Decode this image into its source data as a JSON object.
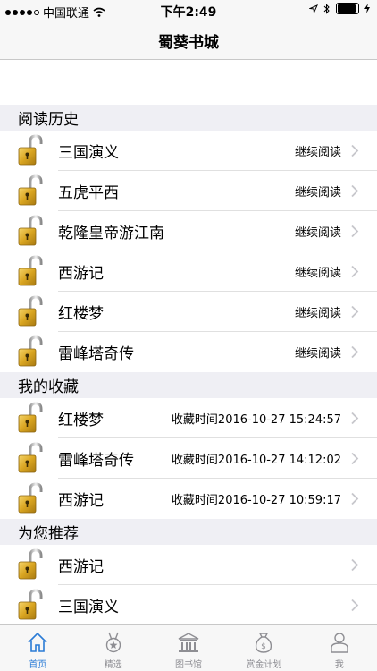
{
  "status_bar": {
    "carrier": "中国联通",
    "time": "下午2:49"
  },
  "nav": {
    "title": "蜀葵书城"
  },
  "sections": {
    "history": {
      "header": "阅读历史",
      "items": [
        {
          "title": "三国演义",
          "action": "继续阅读"
        },
        {
          "title": "五虎平西",
          "action": "继续阅读"
        },
        {
          "title": "乾隆皇帝游江南",
          "action": "继续阅读"
        },
        {
          "title": "西游记",
          "action": "继续阅读"
        },
        {
          "title": "红楼梦",
          "action": "继续阅读"
        },
        {
          "title": "雷峰塔奇传",
          "action": "继续阅读"
        }
      ]
    },
    "favorites": {
      "header": "我的收藏",
      "items": [
        {
          "title": "红楼梦",
          "time": "收藏时间2016-10-27 15:24:57"
        },
        {
          "title": "雷峰塔奇传",
          "time": "收藏时间2016-10-27 14:12:02"
        },
        {
          "title": "西游记",
          "time": "收藏时间2016-10-27 10:59:17"
        }
      ]
    },
    "recommend": {
      "header": "为您推荐",
      "items": [
        {
          "title": "西游记"
        },
        {
          "title": "三国演义"
        }
      ]
    }
  },
  "tabs": [
    {
      "label": "首页",
      "icon": "home-icon",
      "active": true
    },
    {
      "label": "精选",
      "icon": "medal-icon",
      "active": false
    },
    {
      "label": "图书馆",
      "icon": "library-icon",
      "active": false
    },
    {
      "label": "赏金计划",
      "icon": "money-bag-icon",
      "active": false
    },
    {
      "label": "我",
      "icon": "person-icon",
      "active": false
    }
  ],
  "colors": {
    "accent": "#2a7bd6",
    "section_bg": "#efeff4",
    "lock_gold": "#d9a521"
  }
}
